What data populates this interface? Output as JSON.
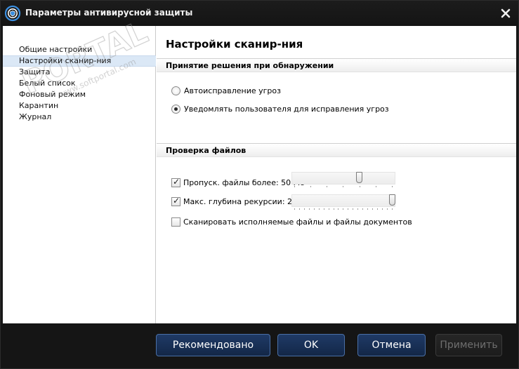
{
  "window": {
    "title": "Параметры антивирусной защиты"
  },
  "sidebar": {
    "items": [
      {
        "label": "Общие настройки",
        "selected": false
      },
      {
        "label": "Настройки сканир-ния",
        "selected": true
      },
      {
        "label": "Защита",
        "selected": false
      },
      {
        "label": "Белый список",
        "selected": false
      },
      {
        "label": "Фоновый режим",
        "selected": false
      },
      {
        "label": "Карантин",
        "selected": false
      },
      {
        "label": "Журнал",
        "selected": false
      }
    ]
  },
  "main": {
    "title": "Настройки сканир-ния",
    "detection": {
      "header": "Принятие решения при обнаружении",
      "options": [
        {
          "label": "Автоисправление угроз",
          "checked": false
        },
        {
          "label": "Уведомлять пользователя для исправления угроз",
          "checked": true
        }
      ]
    },
    "file_check": {
      "header": "Проверка файлов",
      "skip_files": {
        "label": "Пропуск. файлы более: 50 Мб",
        "checked": true,
        "level": 0.66
      },
      "recursion": {
        "label": "Макс. глубина рекурсии: 20",
        "checked": true,
        "level": 1.0
      },
      "scan_exec": {
        "label": "Сканировать исполняемые файлы и файлы документов",
        "checked": false
      }
    }
  },
  "footer": {
    "recommended_label": "Рекомендовано",
    "ok_label": "OK",
    "cancel_label": "Отмена",
    "apply_label": "Применить"
  },
  "watermark": {
    "text_main": "PORTAL",
    "text_url": "www.softportal.com"
  },
  "colors": {
    "accent": "#1f3a66",
    "selection": "#dbe8f6",
    "window_bg": "#171717"
  }
}
